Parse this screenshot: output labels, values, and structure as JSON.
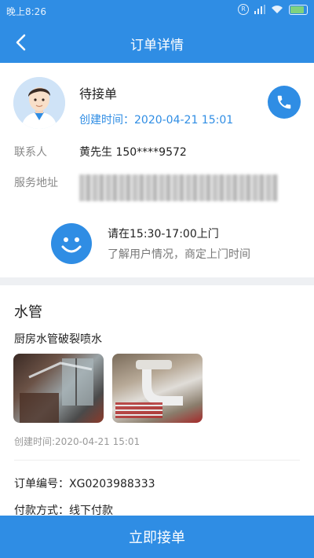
{
  "statusbar": {
    "time": "晚上8:26",
    "r_icon": "R"
  },
  "navbar": {
    "title": "订单详情"
  },
  "order_header": {
    "status": "待接单",
    "created_time": "创建时间：2020-04-21 15:01"
  },
  "contact": {
    "label": "联系人",
    "value": "黄先生  150****9572"
  },
  "address": {
    "label": "服务地址"
  },
  "visit": {
    "time": "请在15:30-17:00上门",
    "hint": "了解用户情况，商定上门时间"
  },
  "detail": {
    "category": "水管",
    "description": "厨房水管破裂喷水",
    "created_time": "创建时间:2020-04-21 15:01"
  },
  "order_info": {
    "order_no": "订单编号：XG0203988333",
    "payment": "付款方式：线下付款"
  },
  "action": {
    "accept_label": "立即接单"
  },
  "colors": {
    "primary": "#2f8de4"
  },
  "icons": [
    "back-arrow-icon",
    "phone-icon",
    "smile-icon",
    "signal-icon",
    "wifi-icon",
    "battery-icon"
  ]
}
